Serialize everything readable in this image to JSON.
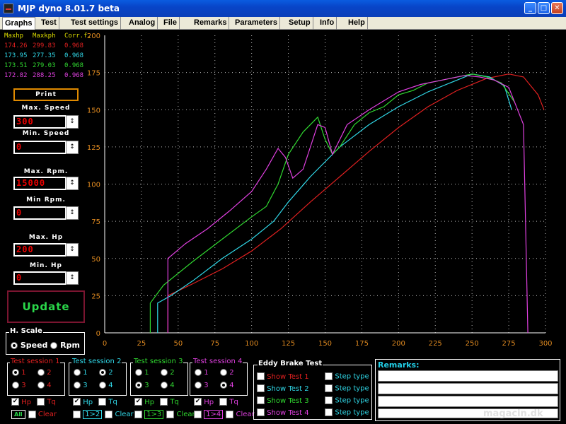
{
  "window": {
    "title": "MJP dyno 8.01.7 beta"
  },
  "tabs": [
    "Graphs",
    "Test",
    "Test settings",
    "Analog",
    "File",
    "Remarks",
    "Parameters",
    "Setup",
    "Info",
    "Help"
  ],
  "max_table": {
    "headers": [
      "Maxhp",
      "Maxkph",
      "Corr.f."
    ],
    "rows": [
      {
        "hp": "174.26",
        "kph": "299.83",
        "corr": "0.968",
        "color": "#e02020"
      },
      {
        "hp": "173.95",
        "kph": "277.35",
        "corr": "0.968",
        "color": "#30d8e8"
      },
      {
        "hp": "173.51",
        "kph": "279.03",
        "corr": "0.968",
        "color": "#30d830"
      },
      {
        "hp": "172.82",
        "kph": "288.25",
        "corr": "0.968",
        "color": "#e040e0"
      }
    ]
  },
  "controls": {
    "print_label": "Print",
    "max_speed_label": "Max. Speed",
    "max_speed_value": "300",
    "min_speed_label": "Min. Speed",
    "min_speed_value": "0",
    "max_rpm_label": "Max. Rpm.",
    "max_rpm_value": "15000",
    "min_rpm_label": "Min Rpm.",
    "min_rpm_value": "0",
    "max_hp_label": "Max. Hp",
    "max_hp_value": "200",
    "min_hp_label": "Min. Hp",
    "min_hp_value": "0",
    "update_label": "Update"
  },
  "hscale": {
    "label": "H. Scale",
    "options": [
      "Speed",
      "Rpm"
    ],
    "selected": "Speed"
  },
  "sessions": [
    {
      "label": "Test session 1",
      "color": "#e02020",
      "options": [
        "1",
        "2",
        "3",
        "4"
      ],
      "selected": "1",
      "hp": "Hp",
      "tq": "Tq",
      "bottom": "All",
      "clear": "Clear"
    },
    {
      "label": "Test session 2",
      "color": "#30d8e8",
      "options": [
        "1",
        "2",
        "3",
        "4"
      ],
      "selected": "2",
      "hp": "Hp",
      "tq": "Tq",
      "bottom": "1>2",
      "clear": "Clear"
    },
    {
      "label": "Test session 3",
      "color": "#30d830",
      "options": [
        "1",
        "2",
        "3",
        "4"
      ],
      "selected": "3",
      "hp": "Hp",
      "tq": "Tq",
      "bottom": "1>3",
      "clear": "Clear"
    },
    {
      "label": "Test session 4",
      "color": "#e040e0",
      "options": [
        "1",
        "2",
        "3",
        "4"
      ],
      "selected": "4",
      "hp": "Hp",
      "tq": "Tq",
      "bottom": "1>4",
      "clear": "Clear"
    }
  ],
  "eddy": {
    "label": "Eddy Brake Test",
    "tests": [
      {
        "show": "Show Test 1",
        "step": "Step type",
        "color": "#e02020"
      },
      {
        "show": "Show Test 2",
        "step": "Step type",
        "color": "#30d8e8"
      },
      {
        "show": "Show Test 3",
        "step": "Step type",
        "color": "#30d830"
      },
      {
        "show": "Show Test 4",
        "step": "Step type",
        "color": "#e040e0"
      }
    ]
  },
  "remarks": {
    "label": "Remarks:"
  },
  "watermark": "magacin.dk",
  "chart_data": {
    "type": "line",
    "xlim": [
      0,
      300
    ],
    "ylim": [
      0,
      200
    ],
    "x_ticks": [
      0,
      25,
      50,
      75,
      100,
      125,
      150,
      175,
      200,
      225,
      250,
      275,
      300
    ],
    "y_ticks": [
      0,
      25,
      50,
      75,
      100,
      125,
      150,
      175,
      200
    ],
    "grid": true,
    "series": [
      {
        "color": "#e02020",
        "points": [
          [
            43,
            0
          ],
          [
            43,
            25
          ],
          [
            60,
            33
          ],
          [
            80,
            43
          ],
          [
            100,
            55
          ],
          [
            120,
            70
          ],
          [
            140,
            88
          ],
          [
            160,
            105
          ],
          [
            180,
            122
          ],
          [
            200,
            138
          ],
          [
            220,
            152
          ],
          [
            240,
            163
          ],
          [
            260,
            171
          ],
          [
            275,
            174
          ],
          [
            285,
            172
          ],
          [
            295,
            160
          ],
          [
            299,
            150
          ]
        ]
      },
      {
        "color": "#30d8e8",
        "points": [
          [
            36,
            0
          ],
          [
            36,
            20
          ],
          [
            45,
            25
          ],
          [
            60,
            35
          ],
          [
            80,
            50
          ],
          [
            100,
            63
          ],
          [
            115,
            75
          ],
          [
            125,
            88
          ],
          [
            140,
            105
          ],
          [
            160,
            125
          ],
          [
            180,
            140
          ],
          [
            200,
            152
          ],
          [
            220,
            162
          ],
          [
            240,
            170
          ],
          [
            250,
            174
          ],
          [
            262,
            172
          ],
          [
            272,
            166
          ],
          [
            277,
            150
          ]
        ]
      },
      {
        "color": "#30d830",
        "points": [
          [
            31,
            0
          ],
          [
            31,
            20
          ],
          [
            40,
            32
          ],
          [
            60,
            48
          ],
          [
            80,
            63
          ],
          [
            100,
            78
          ],
          [
            110,
            85
          ],
          [
            118,
            100
          ],
          [
            125,
            120
          ],
          [
            135,
            135
          ],
          [
            145,
            145
          ],
          [
            150,
            130
          ],
          [
            155,
            120
          ],
          [
            160,
            125
          ],
          [
            170,
            140
          ],
          [
            180,
            148
          ],
          [
            190,
            152
          ],
          [
            200,
            160
          ],
          [
            210,
            163
          ],
          [
            220,
            168
          ],
          [
            230,
            170
          ],
          [
            240,
            172
          ],
          [
            250,
            174
          ],
          [
            260,
            172
          ],
          [
            270,
            168
          ],
          [
            279,
            155
          ]
        ]
      },
      {
        "color": "#e040e0",
        "points": [
          [
            43,
            0
          ],
          [
            43,
            50
          ],
          [
            55,
            60
          ],
          [
            70,
            70
          ],
          [
            85,
            82
          ],
          [
            100,
            95
          ],
          [
            110,
            110
          ],
          [
            118,
            124
          ],
          [
            123,
            118
          ],
          [
            128,
            104
          ],
          [
            135,
            110
          ],
          [
            145,
            140
          ],
          [
            150,
            138
          ],
          [
            155,
            120
          ],
          [
            165,
            140
          ],
          [
            180,
            150
          ],
          [
            200,
            162
          ],
          [
            215,
            167
          ],
          [
            230,
            170
          ],
          [
            245,
            173
          ],
          [
            255,
            172
          ],
          [
            265,
            170
          ],
          [
            275,
            165
          ],
          [
            285,
            140
          ],
          [
            288,
            0
          ]
        ]
      }
    ]
  }
}
